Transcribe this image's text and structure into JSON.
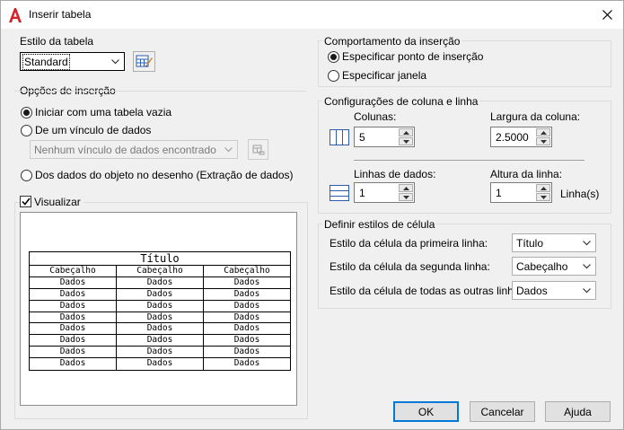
{
  "window": {
    "title": "Inserir tabela"
  },
  "table_style": {
    "group_label": "Estilo da tabela",
    "selected": "Standard"
  },
  "insert_options": {
    "group_label": "Opções de inserção",
    "radio_empty": "Iniciar com uma tabela vazia",
    "radio_link": "De um vínculo de dados",
    "link_select": "Nenhum vínculo de dados encontrado",
    "radio_extract": "Dos dados do objeto no desenho (Extração de dados)"
  },
  "preview": {
    "checkbox_label": "Visualizar",
    "checked": true,
    "title": "Título",
    "headers": [
      "Cabeçalho",
      "Cabeçalho",
      "Cabeçalho"
    ],
    "rows": [
      [
        "Dados",
        "Dados",
        "Dados"
      ],
      [
        "Dados",
        "Dados",
        "Dados"
      ],
      [
        "Dados",
        "Dados",
        "Dados"
      ],
      [
        "Dados",
        "Dados",
        "Dados"
      ],
      [
        "Dados",
        "Dados",
        "Dados"
      ],
      [
        "Dados",
        "Dados",
        "Dados"
      ],
      [
        "Dados",
        "Dados",
        "Dados"
      ],
      [
        "Dados",
        "Dados",
        "Dados"
      ]
    ]
  },
  "insertion_behavior": {
    "group_label": "Comportamento da inserção",
    "radio_point": "Especificar ponto de inserção",
    "radio_window": "Especificar janela"
  },
  "columns_rows": {
    "group_label": "Configurações de coluna e linha",
    "columns_label": "Colunas:",
    "columns_value": "5",
    "col_width_label": "Largura da coluna:",
    "col_width_value": "2.5000",
    "data_rows_label": "Linhas de dados:",
    "data_rows_value": "1",
    "row_height_label": "Altura da linha:",
    "row_height_value": "1",
    "row_height_unit": "Linha(s)"
  },
  "cell_styles": {
    "group_label": "Definir estilos de célula",
    "first_row_label": "Estilo da célula da primeira linha:",
    "first_row_value": "Título",
    "second_row_label": "Estilo da célula da segunda linha:",
    "second_row_value": "Cabeçalho",
    "other_rows_label": "Estilo da célula de todas as outras linhas:",
    "other_rows_value": "Dados"
  },
  "buttons": {
    "ok": "OK",
    "cancel": "Cancelar",
    "help": "Ajuda"
  }
}
